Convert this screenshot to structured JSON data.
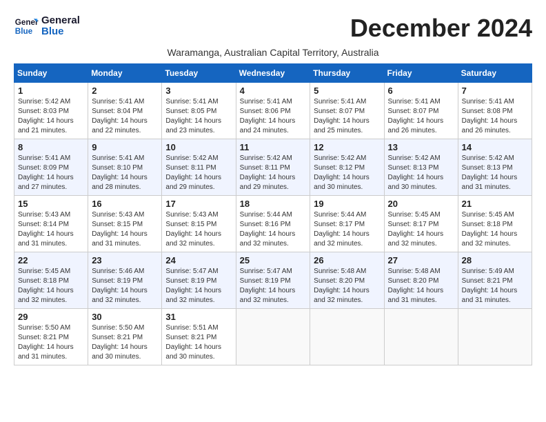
{
  "logo": {
    "line1": "General",
    "line2": "Blue"
  },
  "title": "December 2024",
  "subtitle": "Waramanga, Australian Capital Territory, Australia",
  "header_color": "#1565c0",
  "days_of_week": [
    "Sunday",
    "Monday",
    "Tuesday",
    "Wednesday",
    "Thursday",
    "Friday",
    "Saturday"
  ],
  "weeks": [
    [
      {
        "day": "1",
        "sunrise": "Sunrise: 5:42 AM",
        "sunset": "Sunset: 8:03 PM",
        "daylight": "Daylight: 14 hours and 21 minutes."
      },
      {
        "day": "2",
        "sunrise": "Sunrise: 5:41 AM",
        "sunset": "Sunset: 8:04 PM",
        "daylight": "Daylight: 14 hours and 22 minutes."
      },
      {
        "day": "3",
        "sunrise": "Sunrise: 5:41 AM",
        "sunset": "Sunset: 8:05 PM",
        "daylight": "Daylight: 14 hours and 23 minutes."
      },
      {
        "day": "4",
        "sunrise": "Sunrise: 5:41 AM",
        "sunset": "Sunset: 8:06 PM",
        "daylight": "Daylight: 14 hours and 24 minutes."
      },
      {
        "day": "5",
        "sunrise": "Sunrise: 5:41 AM",
        "sunset": "Sunset: 8:07 PM",
        "daylight": "Daylight: 14 hours and 25 minutes."
      },
      {
        "day": "6",
        "sunrise": "Sunrise: 5:41 AM",
        "sunset": "Sunset: 8:07 PM",
        "daylight": "Daylight: 14 hours and 26 minutes."
      },
      {
        "day": "7",
        "sunrise": "Sunrise: 5:41 AM",
        "sunset": "Sunset: 8:08 PM",
        "daylight": "Daylight: 14 hours and 26 minutes."
      }
    ],
    [
      {
        "day": "8",
        "sunrise": "Sunrise: 5:41 AM",
        "sunset": "Sunset: 8:09 PM",
        "daylight": "Daylight: 14 hours and 27 minutes."
      },
      {
        "day": "9",
        "sunrise": "Sunrise: 5:41 AM",
        "sunset": "Sunset: 8:10 PM",
        "daylight": "Daylight: 14 hours and 28 minutes."
      },
      {
        "day": "10",
        "sunrise": "Sunrise: 5:42 AM",
        "sunset": "Sunset: 8:11 PM",
        "daylight": "Daylight: 14 hours and 29 minutes."
      },
      {
        "day": "11",
        "sunrise": "Sunrise: 5:42 AM",
        "sunset": "Sunset: 8:11 PM",
        "daylight": "Daylight: 14 hours and 29 minutes."
      },
      {
        "day": "12",
        "sunrise": "Sunrise: 5:42 AM",
        "sunset": "Sunset: 8:12 PM",
        "daylight": "Daylight: 14 hours and 30 minutes."
      },
      {
        "day": "13",
        "sunrise": "Sunrise: 5:42 AM",
        "sunset": "Sunset: 8:13 PM",
        "daylight": "Daylight: 14 hours and 30 minutes."
      },
      {
        "day": "14",
        "sunrise": "Sunrise: 5:42 AM",
        "sunset": "Sunset: 8:13 PM",
        "daylight": "Daylight: 14 hours and 31 minutes."
      }
    ],
    [
      {
        "day": "15",
        "sunrise": "Sunrise: 5:43 AM",
        "sunset": "Sunset: 8:14 PM",
        "daylight": "Daylight: 14 hours and 31 minutes."
      },
      {
        "day": "16",
        "sunrise": "Sunrise: 5:43 AM",
        "sunset": "Sunset: 8:15 PM",
        "daylight": "Daylight: 14 hours and 31 minutes."
      },
      {
        "day": "17",
        "sunrise": "Sunrise: 5:43 AM",
        "sunset": "Sunset: 8:15 PM",
        "daylight": "Daylight: 14 hours and 32 minutes."
      },
      {
        "day": "18",
        "sunrise": "Sunrise: 5:44 AM",
        "sunset": "Sunset: 8:16 PM",
        "daylight": "Daylight: 14 hours and 32 minutes."
      },
      {
        "day": "19",
        "sunrise": "Sunrise: 5:44 AM",
        "sunset": "Sunset: 8:17 PM",
        "daylight": "Daylight: 14 hours and 32 minutes."
      },
      {
        "day": "20",
        "sunrise": "Sunrise: 5:45 AM",
        "sunset": "Sunset: 8:17 PM",
        "daylight": "Daylight: 14 hours and 32 minutes."
      },
      {
        "day": "21",
        "sunrise": "Sunrise: 5:45 AM",
        "sunset": "Sunset: 8:18 PM",
        "daylight": "Daylight: 14 hours and 32 minutes."
      }
    ],
    [
      {
        "day": "22",
        "sunrise": "Sunrise: 5:45 AM",
        "sunset": "Sunset: 8:18 PM",
        "daylight": "Daylight: 14 hours and 32 minutes."
      },
      {
        "day": "23",
        "sunrise": "Sunrise: 5:46 AM",
        "sunset": "Sunset: 8:19 PM",
        "daylight": "Daylight: 14 hours and 32 minutes."
      },
      {
        "day": "24",
        "sunrise": "Sunrise: 5:47 AM",
        "sunset": "Sunset: 8:19 PM",
        "daylight": "Daylight: 14 hours and 32 minutes."
      },
      {
        "day": "25",
        "sunrise": "Sunrise: 5:47 AM",
        "sunset": "Sunset: 8:19 PM",
        "daylight": "Daylight: 14 hours and 32 minutes."
      },
      {
        "day": "26",
        "sunrise": "Sunrise: 5:48 AM",
        "sunset": "Sunset: 8:20 PM",
        "daylight": "Daylight: 14 hours and 32 minutes."
      },
      {
        "day": "27",
        "sunrise": "Sunrise: 5:48 AM",
        "sunset": "Sunset: 8:20 PM",
        "daylight": "Daylight: 14 hours and 31 minutes."
      },
      {
        "day": "28",
        "sunrise": "Sunrise: 5:49 AM",
        "sunset": "Sunset: 8:21 PM",
        "daylight": "Daylight: 14 hours and 31 minutes."
      }
    ],
    [
      {
        "day": "29",
        "sunrise": "Sunrise: 5:50 AM",
        "sunset": "Sunset: 8:21 PM",
        "daylight": "Daylight: 14 hours and 31 minutes."
      },
      {
        "day": "30",
        "sunrise": "Sunrise: 5:50 AM",
        "sunset": "Sunset: 8:21 PM",
        "daylight": "Daylight: 14 hours and 30 minutes."
      },
      {
        "day": "31",
        "sunrise": "Sunrise: 5:51 AM",
        "sunset": "Sunset: 8:21 PM",
        "daylight": "Daylight: 14 hours and 30 minutes."
      },
      null,
      null,
      null,
      null
    ]
  ]
}
